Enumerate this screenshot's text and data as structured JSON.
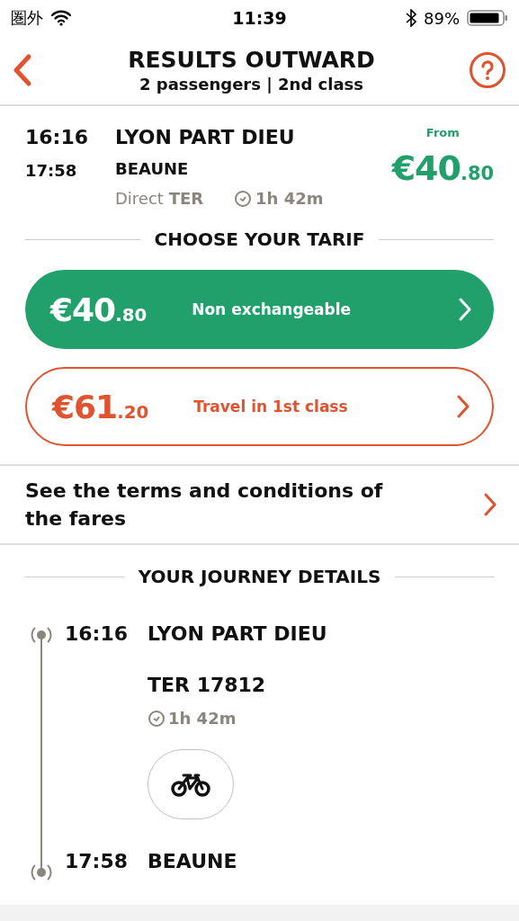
{
  "status_bar": {
    "carrier": "圏外",
    "time": "11:39",
    "battery": "89%"
  },
  "header": {
    "title": "RESULTS OUTWARD",
    "subtitle": "2 passengers | 2nd class"
  },
  "journey": {
    "depart_time": "16:16",
    "arrive_time": "17:58",
    "origin": "LYON PART DIEU",
    "destination": "BEAUNE",
    "type_prefix": "Direct",
    "type": "TER",
    "duration": "1h 42m",
    "from_label": "From",
    "price": {
      "whole": "€40",
      "cents": ".80"
    }
  },
  "tarif_heading": "CHOOSE YOUR TARIF",
  "tarifs": [
    {
      "kind": "filled",
      "price": {
        "whole": "€40",
        "cents": ".80"
      },
      "label": "Non exchangeable"
    },
    {
      "kind": "outline",
      "price": {
        "whole": "€61",
        "cents": ".20"
      },
      "label": "Travel in 1st class"
    }
  ],
  "terms_link": "See the terms and conditions of the fares",
  "details_heading": "YOUR JOURNEY DETAILS",
  "details": {
    "depart_time": "16:16",
    "origin": "LYON PART DIEU",
    "train": "TER 17812",
    "duration": "1h 42m",
    "arrive_time": "17:58",
    "destination": "BEAUNE"
  }
}
